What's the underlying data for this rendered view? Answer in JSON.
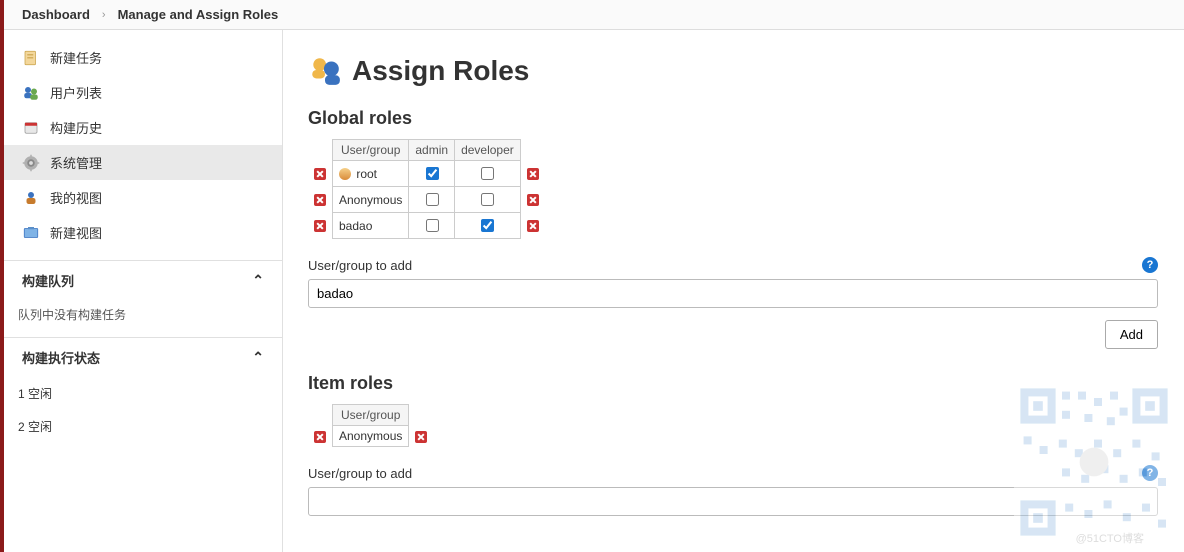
{
  "breadcrumb": {
    "home": "Dashboard",
    "current": "Manage and Assign Roles"
  },
  "sidebar": {
    "items": [
      {
        "label": "新建任务",
        "icon": "doc"
      },
      {
        "label": "用户列表",
        "icon": "users"
      },
      {
        "label": "构建历史",
        "icon": "history"
      },
      {
        "label": "系统管理",
        "icon": "gear",
        "active": true
      },
      {
        "label": "我的视图",
        "icon": "myview"
      },
      {
        "label": "新建视图",
        "icon": "newview"
      }
    ],
    "queue": {
      "title": "构建队列",
      "empty": "队列中没有构建任务"
    },
    "exec": {
      "title": "构建执行状态",
      "rows": [
        "1  空闲",
        "2  空闲"
      ]
    }
  },
  "page": {
    "title": "Assign Roles",
    "global": {
      "heading": "Global roles",
      "cols": [
        "User/group",
        "admin",
        "developer"
      ],
      "rows": [
        {
          "name": "root",
          "userIcon": true,
          "admin": true,
          "developer": false
        },
        {
          "name": "Anonymous",
          "userIcon": false,
          "admin": false,
          "developer": false
        },
        {
          "name": "badao",
          "userIcon": false,
          "admin": false,
          "developer": true
        }
      ],
      "addLabel": "User/group to add",
      "addValue": "badao",
      "addButton": "Add"
    },
    "item": {
      "heading": "Item roles",
      "cols": [
        "User/group"
      ],
      "rows": [
        {
          "name": "Anonymous"
        }
      ],
      "addLabel": "User/group to add",
      "addValue": ""
    }
  },
  "watermark": "@51CTO博客"
}
